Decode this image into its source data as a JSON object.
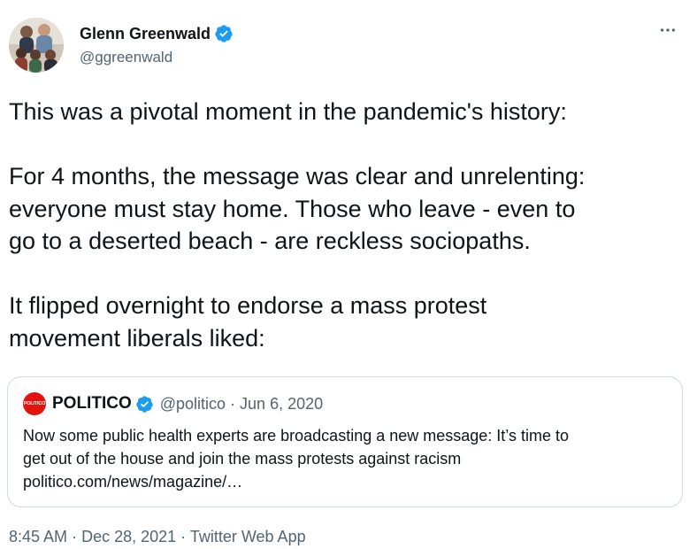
{
  "author": {
    "name": "Glenn Greenwald",
    "handle": "@ggreenwald"
  },
  "tweet": {
    "line1": "This was a pivotal moment in the pandemic's history:",
    "para2_l1": "For 4 months, the message was clear and unrelenting:",
    "para2_l2": "everyone must stay home. Those who leave - even to",
    "para2_l3": "go to a deserted beach - are reckless sociopaths.",
    "para3_l1": "It flipped overnight to endorse a mass protest",
    "para3_l2": "movement liberals liked:"
  },
  "quote": {
    "logo_text": "POLITICO",
    "name": "POLITICO",
    "handle": "@politico",
    "separator": "·",
    "date": "Jun 6, 2020",
    "text_l1": "Now some public health experts are broadcasting a new message: It’s time to",
    "text_l2": "get out of the house and join the mass protests against racism",
    "text_l3": "politico.com/news/magazine/…"
  },
  "footer": {
    "time": "8:45 AM",
    "sep1": "·",
    "date": "Dec 28, 2021",
    "sep2": "·",
    "source": "Twitter Web App"
  },
  "colors": {
    "verified": "#1d9bf0",
    "secondary_text": "#536471",
    "politico_red": "#e3120b",
    "border": "#cfd9de"
  },
  "icons": {
    "verified": "verified-badge-icon",
    "more": "more-horizontal-icon"
  }
}
